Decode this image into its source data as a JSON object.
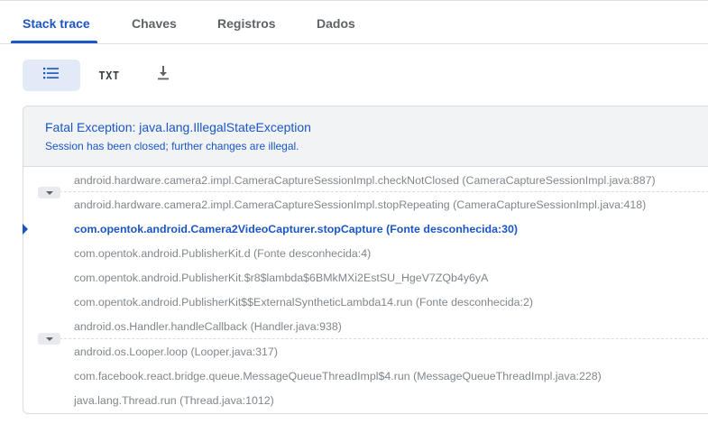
{
  "tabs": [
    {
      "label": "Stack trace",
      "active": true
    },
    {
      "label": "Chaves",
      "active": false
    },
    {
      "label": "Registros",
      "active": false
    },
    {
      "label": "Dados",
      "active": false
    }
  ],
  "toolbar": {
    "list_view_icon": "list-icon",
    "txt_label": "TXT",
    "download_icon": "download-icon"
  },
  "exception": {
    "title": "Fatal Exception: java.lang.IllegalStateException",
    "message": "Session has been closed; further changes are illegal."
  },
  "frames": [
    {
      "text": "android.hardware.camera2.impl.CameraCaptureSessionImpl.checkNotClosed (CameraCaptureSessionImpl.java:887)",
      "highlight": false
    },
    {
      "text": "android.hardware.camera2.impl.CameraCaptureSessionImpl.stopRepeating (CameraCaptureSessionImpl.java:418)",
      "highlight": false
    },
    {
      "text": "com.opentok.android.Camera2VideoCapturer.stopCapture (Fonte desconhecida:30)",
      "highlight": true
    },
    {
      "text": "com.opentok.android.PublisherKit.d (Fonte desconhecida:4)",
      "highlight": false
    },
    {
      "text": "com.opentok.android.PublisherKit.$r8$lambda$6BMkMXi2EstSU_HgeV7ZQb4y6yA",
      "highlight": false
    },
    {
      "text": "com.opentok.android.PublisherKit$$ExternalSyntheticLambda14.run (Fonte desconhecida:2)",
      "highlight": false
    },
    {
      "text": "android.os.Handler.handleCallback (Handler.java:938)",
      "highlight": false
    },
    {
      "text": "android.os.Looper.loop (Looper.java:317)",
      "highlight": false
    },
    {
      "text": "com.facebook.react.bridge.queue.MessageQueueThreadImpl$4.run (MessageQueueThreadImpl.java:228)",
      "highlight": false
    },
    {
      "text": "java.lang.Thread.run (Thread.java:1012)",
      "highlight": false
    }
  ],
  "colors": {
    "accent": "#1a56c4",
    "frame_text": "#80868b",
    "header_bg": "#f1f3f4"
  }
}
